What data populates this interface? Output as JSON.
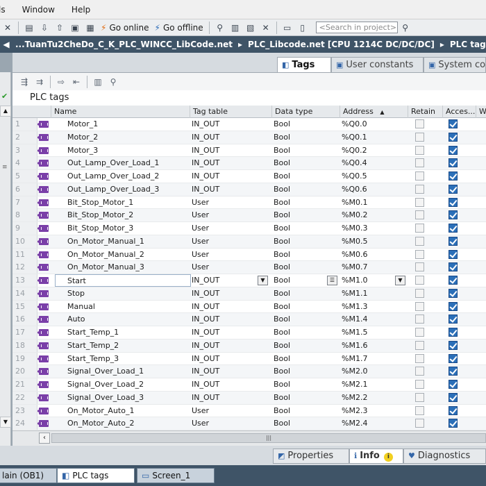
{
  "menu": [
    "ls",
    "Window",
    "Help"
  ],
  "toolbar": {
    "go_online": "Go online",
    "go_offline": "Go offline",
    "search_placeholder": "<Search in project>"
  },
  "breadcrumb": [
    "...TuanTu2CheDo_C_K_PLC_WINCC_LibCode.net",
    "PLC_Libcode.net [CPU 1214C DC/DC/DC]",
    "PLC tags"
  ],
  "tabs": [
    {
      "label": "Tags",
      "active": true
    },
    {
      "label": "User constants",
      "active": false
    },
    {
      "label": "System co",
      "active": false
    }
  ],
  "panel_title": "PLC tags",
  "columns": {
    "name": "Name",
    "tag_table": "Tag table",
    "data_type": "Data type",
    "address": "Address",
    "address_sort": "▲",
    "retain": "Retain",
    "access": "Acces...",
    "w": "W"
  },
  "rows": [
    {
      "num": "1",
      "name": "Motor_1",
      "table": "IN_OUT",
      "type": "Bool",
      "addr": "%Q0.0"
    },
    {
      "num": "2",
      "name": "Motor_2",
      "table": "IN_OUT",
      "type": "Bool",
      "addr": "%Q0.1"
    },
    {
      "num": "3",
      "name": "Motor_3",
      "table": "IN_OUT",
      "type": "Bool",
      "addr": "%Q0.2"
    },
    {
      "num": "4",
      "name": "Out_Lamp_Over_Load_1",
      "table": "IN_OUT",
      "type": "Bool",
      "addr": "%Q0.4"
    },
    {
      "num": "5",
      "name": "Out_Lamp_Over_Load_2",
      "table": "IN_OUT",
      "type": "Bool",
      "addr": "%Q0.5"
    },
    {
      "num": "6",
      "name": "Out_Lamp_Over_Load_3",
      "table": "IN_OUT",
      "type": "Bool",
      "addr": "%Q0.6"
    },
    {
      "num": "7",
      "name": "Bit_Stop_Motor_1",
      "table": "User",
      "type": "Bool",
      "addr": "%M0.1"
    },
    {
      "num": "8",
      "name": "Bit_Stop_Motor_2",
      "table": "User",
      "type": "Bool",
      "addr": "%M0.2"
    },
    {
      "num": "9",
      "name": "Bit_Stop_Motor_3",
      "table": "User",
      "type": "Bool",
      "addr": "%M0.3"
    },
    {
      "num": "10",
      "name": "On_Motor_Manual_1",
      "table": "User",
      "type": "Bool",
      "addr": "%M0.5"
    },
    {
      "num": "11",
      "name": "On_Motor_Manual_2",
      "table": "User",
      "type": "Bool",
      "addr": "%M0.6"
    },
    {
      "num": "12",
      "name": "On_Motor_Manual_3",
      "table": "User",
      "type": "Bool",
      "addr": "%M0.7"
    },
    {
      "num": "13",
      "name": "Start",
      "table": "IN_OUT",
      "type": "Bool",
      "addr": "%M1.0"
    },
    {
      "num": "14",
      "name": "Stop",
      "table": "IN_OUT",
      "type": "Bool",
      "addr": "%M1.1"
    },
    {
      "num": "15",
      "name": "Manual",
      "table": "IN_OUT",
      "type": "Bool",
      "addr": "%M1.3"
    },
    {
      "num": "16",
      "name": "Auto",
      "table": "IN_OUT",
      "type": "Bool",
      "addr": "%M1.4"
    },
    {
      "num": "17",
      "name": "Start_Temp_1",
      "table": "IN_OUT",
      "type": "Bool",
      "addr": "%M1.5"
    },
    {
      "num": "18",
      "name": "Start_Temp_2",
      "table": "IN_OUT",
      "type": "Bool",
      "addr": "%M1.6"
    },
    {
      "num": "19",
      "name": "Start_Temp_3",
      "table": "IN_OUT",
      "type": "Bool",
      "addr": "%M1.7"
    },
    {
      "num": "20",
      "name": "Signal_Over_Load_1",
      "table": "IN_OUT",
      "type": "Bool",
      "addr": "%M2.0"
    },
    {
      "num": "21",
      "name": "Signal_Over_Load_2",
      "table": "IN_OUT",
      "type": "Bool",
      "addr": "%M2.1"
    },
    {
      "num": "22",
      "name": "Signal_Over_Load_3",
      "table": "IN_OUT",
      "type": "Bool",
      "addr": "%M2.2"
    },
    {
      "num": "23",
      "name": "On_Motor_Auto_1",
      "table": "User",
      "type": "Bool",
      "addr": "%M2.3"
    },
    {
      "num": "24",
      "name": "On_Motor_Auto_2",
      "table": "User",
      "type": "Bool",
      "addr": "%M2.4"
    }
  ],
  "inspector_tabs": [
    {
      "label": "Properties",
      "active": false
    },
    {
      "label": "Info",
      "active": true
    },
    {
      "label": "Diagnostics",
      "active": false
    }
  ],
  "taskbar": [
    {
      "label": "lain (OB1)",
      "active": false
    },
    {
      "label": "PLC tags",
      "active": true
    },
    {
      "label": "Screen_1",
      "active": false
    }
  ],
  "colors": {
    "header_bar": "#3f5467",
    "checkbox_on": "#2b6fb8",
    "tag_icon": "#7a3fa8"
  }
}
